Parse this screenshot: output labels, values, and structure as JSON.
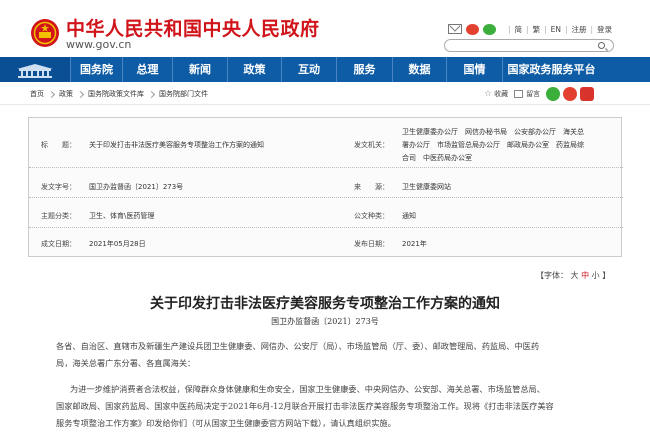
{
  "header": {
    "site_title": "中华人民共和国中央人民政府",
    "site_url": "www.gov.cn",
    "links": [
      "简",
      "繁",
      "EN",
      "注册",
      "登录"
    ]
  },
  "nav": {
    "items": [
      "国务院",
      "总理",
      "新闻",
      "政策",
      "互动",
      "服务",
      "数据",
      "国情",
      "国家政务服务平台"
    ]
  },
  "breadcrumb": [
    "首页",
    "政策",
    "国务院政策文件库",
    "国务院部门文件"
  ],
  "tools": {
    "favorite": "收藏",
    "print": "留言"
  },
  "info": {
    "title_label": "标　　题：",
    "title_value": "关于印发打击非法医疗美容服务专项整治工作方案的通知",
    "issuer_label": "发文机关：",
    "issuer_value_1": "卫生健康委办公厅　网信办秘书局　公安部办公厅　海关总",
    "issuer_value_2": "署办公厅　市场监管总局办公厅　邮政局办公室　药监局综",
    "issuer_value_3": "合司　中医药局办公室",
    "doc_no_label": "发文字号：",
    "doc_no_value": "国卫办监督函〔2021〕273号",
    "source_label": "来　　源：",
    "source_value": "卫生健康委网站",
    "category_label": "主题分类：",
    "category_value": "卫生、体育\\医药管理",
    "doc_type_label": "公文种类：",
    "doc_type_value": "通知",
    "written_label": "成文日期：",
    "written_value": "2021年05月28日",
    "published_label": "发布日期：",
    "published_value": "2021年"
  },
  "font_size_ctrl": {
    "open": "【字体：",
    "large": "大",
    "medium": "中",
    "small": "小",
    "close": "】"
  },
  "document": {
    "title": "关于印发打击非法医疗美容服务专项整治工作方案的通知",
    "number": "国卫办监督函〔2021〕273号",
    "addressee_1": "各省、自治区、直辖市及新疆生产建设兵团卫生健康委、网信办、公安厅（局）、市场监管局（厅、委）、邮政管理局、药监局、中医药",
    "addressee_2": "局，海关总署广东分署、各直属海关：",
    "para_1": "为进一步维护消费者合法权益，保障群众身体健康和生命安全，国家卫生健康委、中央网信办、公安部、海关总署、市场监管总局、",
    "para_2": "国家邮政局、国家药监局、国家中医药局决定于2021年6月-12月联合开展打击非法医疗美容服务专项整治工作。现将《打击非法医疗美容",
    "para_3": "服务专项整治工作方案》印发给你们（可从国家卫生健康委官方网站下载），请认真组织实施。"
  },
  "colors": {
    "brand_red": "#d0141a",
    "nav_blue": "#0e5ba6"
  }
}
